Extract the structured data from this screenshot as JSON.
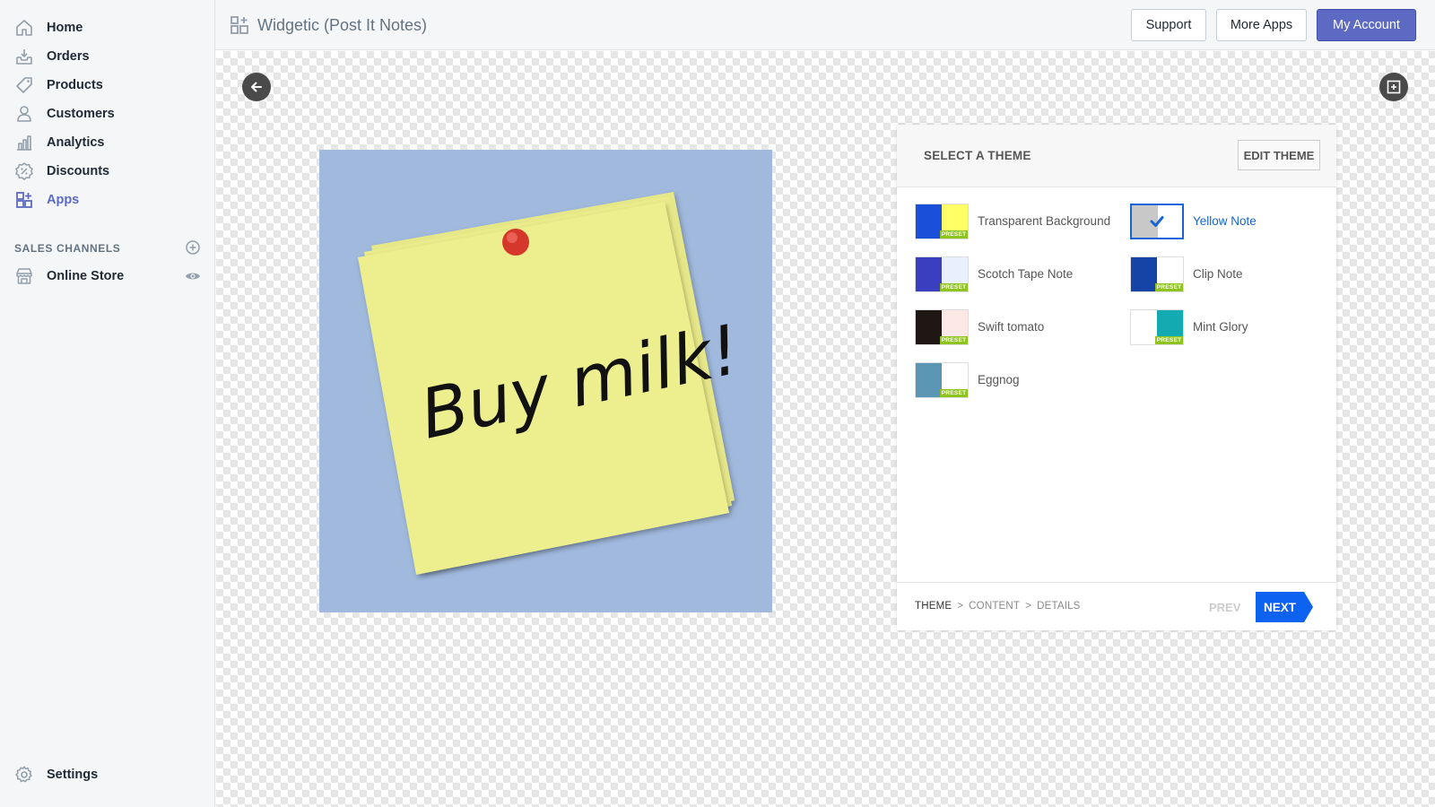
{
  "sidebar": {
    "items": [
      {
        "label": "Home",
        "icon": "home-icon"
      },
      {
        "label": "Orders",
        "icon": "orders-icon"
      },
      {
        "label": "Products",
        "icon": "products-tag-icon"
      },
      {
        "label": "Customers",
        "icon": "customers-icon"
      },
      {
        "label": "Analytics",
        "icon": "analytics-icon"
      },
      {
        "label": "Discounts",
        "icon": "discounts-icon"
      },
      {
        "label": "Apps",
        "icon": "apps-icon",
        "active": true
      }
    ],
    "channels_title": "SALES CHANNELS",
    "channels": [
      {
        "label": "Online Store",
        "icon": "online-store-icon"
      }
    ],
    "settings_label": "Settings"
  },
  "header": {
    "title": "Widgetic (Post It Notes)",
    "support_label": "Support",
    "more_apps_label": "More Apps",
    "account_label": "My Account"
  },
  "preview": {
    "note_text": "Buy milk!",
    "background_color": "#a0b9dd",
    "note_color": "#edee8e",
    "pin_color": "#d6372b"
  },
  "panel": {
    "title": "SELECT A THEME",
    "edit_label": "EDIT THEME",
    "preset_label": "PRESET",
    "themes": [
      {
        "name": "Transparent Background",
        "left": "#1a4fd9",
        "right": "#ffff66",
        "preset": true
      },
      {
        "name": "Yellow Note",
        "left": "#c8c8c8",
        "right": "#ffffff",
        "preset": false,
        "selected": true
      },
      {
        "name": "Scotch Tape Note",
        "left": "#3a3fc0",
        "right": "#e8f0fd",
        "preset": true
      },
      {
        "name": "Clip Note",
        "left": "#1544a6",
        "right": "#ffffff",
        "preset": true
      },
      {
        "name": "Swift tomato",
        "left": "#1e1714",
        "right": "#fde8e6",
        "preset": true
      },
      {
        "name": "Mint Glory",
        "left": "#ffffff",
        "right": "#14aab1",
        "preset": true
      },
      {
        "name": "Eggnog",
        "left": "#5b96b4",
        "right": "#ffffff",
        "preset": true
      }
    ],
    "steps": [
      "THEME",
      "CONTENT",
      "DETAILS"
    ],
    "step_separator": ">",
    "prev_label": "PREV",
    "next_label": "NEXT"
  },
  "colors": {
    "accent": "#5c6ac4",
    "selected_blue": "#1565d8",
    "next_button": "#0d63f0"
  }
}
